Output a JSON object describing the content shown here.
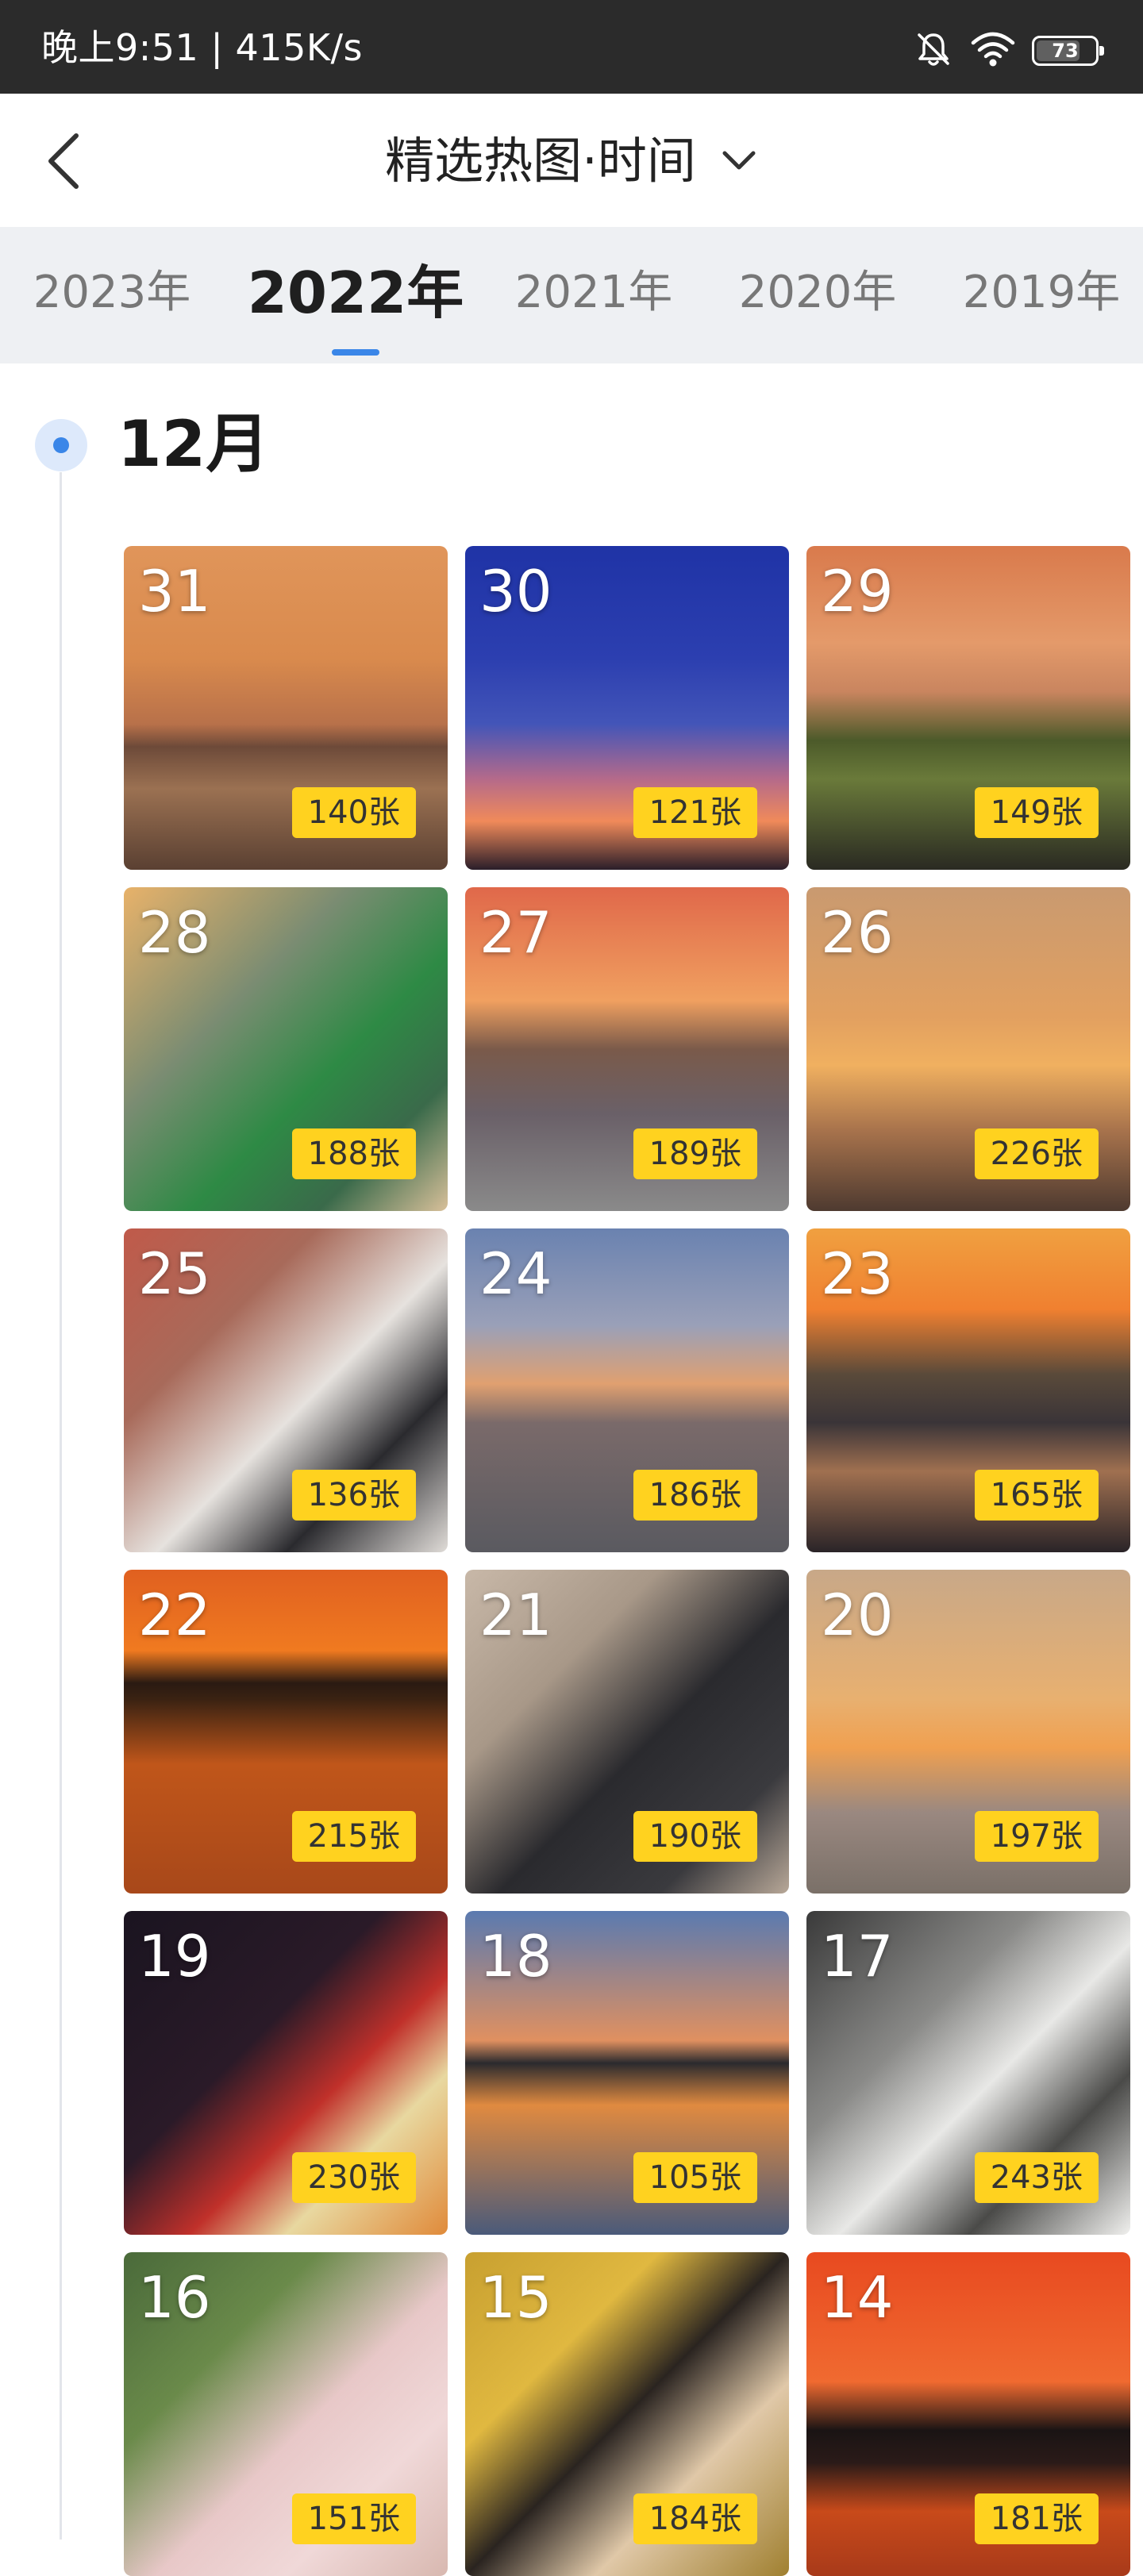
{
  "status_bar": {
    "text": "晚上9:51 | 415K/s",
    "icons": [
      "mute-bell-icon",
      "wifi-icon",
      "battery-icon"
    ],
    "battery_level": "73"
  },
  "nav": {
    "title": "精选热图·时间",
    "back_icon": "chevron-left-icon",
    "dropdown_icon": "chevron-down-icon"
  },
  "year_tabs": [
    "2023年",
    "2022年",
    "2021年",
    "2020年",
    "2019年"
  ],
  "active_year_index": 1,
  "month": "12月",
  "colors": {
    "accent": "#3a86e8",
    "badge": "#ffd21f",
    "tab_bar_bg": "#eef0f3"
  },
  "photos": [
    {
      "day": "31",
      "count": "140张",
      "theme": "sunset-bridge"
    },
    {
      "day": "30",
      "count": "121张",
      "theme": "blue-dusk"
    },
    {
      "day": "29",
      "count": "149张",
      "theme": "pavilion-clouds"
    },
    {
      "day": "28",
      "count": "188张",
      "theme": "girl-green"
    },
    {
      "day": "27",
      "count": "189张",
      "theme": "railway-sunset"
    },
    {
      "day": "26",
      "count": "226张",
      "theme": "hazy-sunset"
    },
    {
      "day": "25",
      "count": "136张",
      "theme": "girl-camera"
    },
    {
      "day": "24",
      "count": "186张",
      "theme": "city-dawn"
    },
    {
      "day": "23",
      "count": "165张",
      "theme": "river-sunset"
    },
    {
      "day": "22",
      "count": "215张",
      "theme": "lake-sunset"
    },
    {
      "day": "21",
      "count": "190张",
      "theme": "girl-hoodie"
    },
    {
      "day": "20",
      "count": "197张",
      "theme": "golden-city"
    },
    {
      "day": "19",
      "count": "230张",
      "theme": "fruit-bowl"
    },
    {
      "day": "18",
      "count": "105张",
      "theme": "reflection-clouds"
    },
    {
      "day": "17",
      "count": "243张",
      "theme": "snow-forest"
    },
    {
      "day": "16",
      "count": "151张",
      "theme": "girl-pink"
    },
    {
      "day": "15",
      "count": "184张",
      "theme": "girl-leaf"
    },
    {
      "day": "14",
      "count": "181张",
      "theme": "red-skyline"
    }
  ]
}
